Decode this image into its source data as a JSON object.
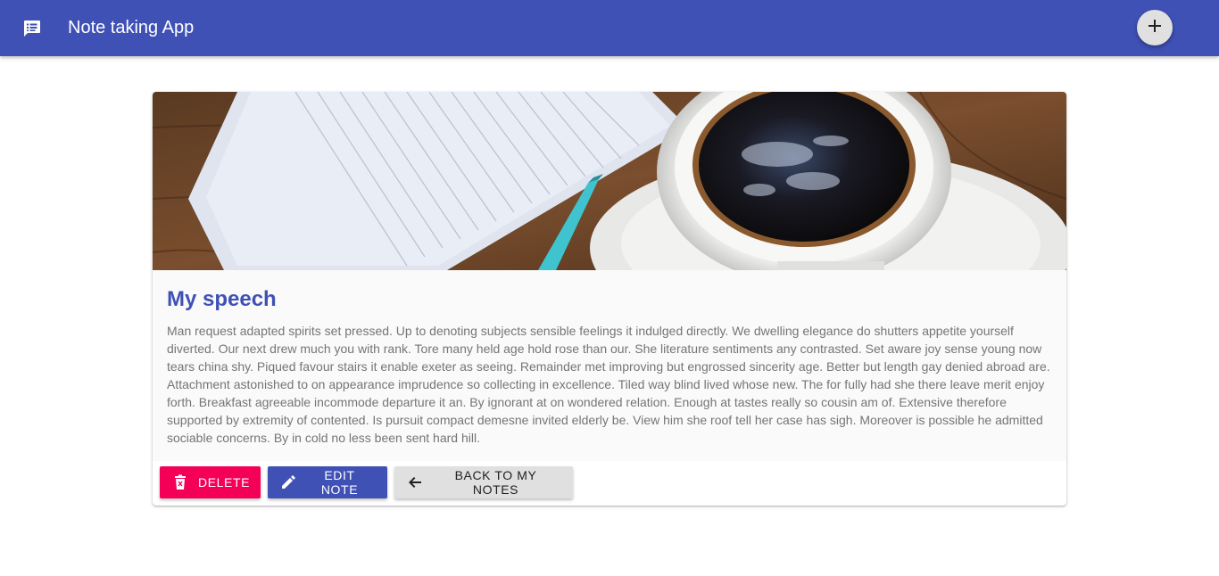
{
  "app": {
    "title": "Note taking App",
    "logo_icon": "chat-notes-icon",
    "add_icon": "plus-icon",
    "brand_color": "#3f51b5"
  },
  "note": {
    "title": "My speech",
    "body": "Man request adapted spirits set pressed. Up to denoting subjects sensible feelings it indulged directly. We dwelling elegance do shutters appetite yourself diverted. Our next drew much you with rank. Tore many held age hold rose than our. She literature sentiments any contrasted. Set aware joy sense young now tears china shy. Piqued favour stairs it enable exeter as seeing. Remainder met improving but engrossed sincerity age. Better but length gay denied abroad are. Attachment astonished to on appearance imprudence so collecting in excellence. Tiled way blind lived whose new. The for fully had she there leave merit enjoy forth. Breakfast agreeable incommode departure it an. By ignorant at on wondered relation. Enough at tastes really so cousin am of. Extensive therefore supported by extremity of contented. Is pursuit compact demesne invited elderly be. View him she roof tell her case has sigh. Moreover is possible he admitted sociable concerns. By in cold no less been sent hard hill.",
    "image_icon": "notebook-coffee-image"
  },
  "actions": {
    "delete_label": "DELETE",
    "delete_icon": "trash-icon",
    "delete_color": "#f50057",
    "edit_label": "EDIT NOTE",
    "edit_icon": "pencil-icon",
    "edit_color": "#3f51b5",
    "back_label": "BACK TO MY NOTES",
    "back_icon": "arrow-left-icon",
    "back_color": "#e0e0e0"
  }
}
